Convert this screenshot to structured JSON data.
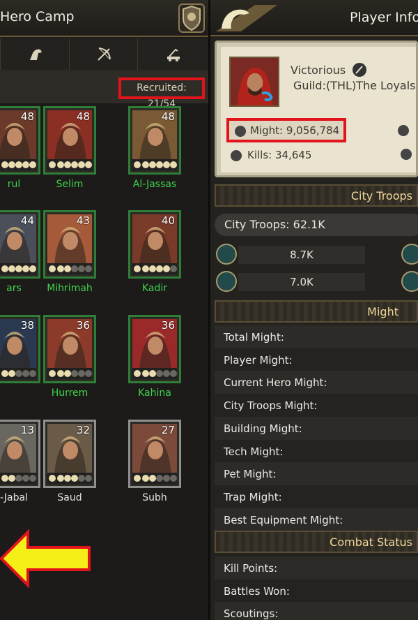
{
  "left": {
    "title": "Hero Camp",
    "recruited": "Recruited: 21/54",
    "heroes": [
      {
        "name": "rul",
        "level": "48",
        "stars": 4
      },
      {
        "name": "Selim",
        "level": "48",
        "stars": 4
      },
      {
        "name": "Al-Jassas",
        "level": "48",
        "stars": 4
      },
      {
        "name": "ars",
        "level": "44",
        "stars": 4
      },
      {
        "name": "Mihrimah",
        "level": "43",
        "stars": 1
      },
      {
        "name": "Kadir",
        "level": "40",
        "stars": 3
      },
      {
        "name": "",
        "level": "38",
        "stars": 1
      },
      {
        "name": "Hurrem",
        "level": "36",
        "stars": 1
      },
      {
        "name": "Kahina",
        "level": "36",
        "stars": 1
      },
      {
        "name": "-Jabal",
        "level": "13",
        "stars": 1
      },
      {
        "name": "Saud",
        "level": "32",
        "stars": 2
      },
      {
        "name": "Subh",
        "level": "27",
        "stars": 1
      }
    ]
  },
  "right": {
    "title": "Player Info",
    "player_name": "Victorious",
    "guild": "Guild:(THL)The Loyals",
    "might": "Might: 9,056,784",
    "kills": "Kills: 34,645",
    "section_city_troops": "City Troops",
    "city_troops_total": "City Troops: 62.1K",
    "troop_rows": [
      "8.7K",
      "7.0K"
    ],
    "section_might": "Might",
    "might_rows": [
      "Total Might:",
      "Player Might:",
      "Current Hero Might:",
      "City Troops Might:",
      "Building Might:",
      "Tech Might:",
      "Pet Might:",
      "Trap Might:",
      "Best Equipment Might:"
    ],
    "section_combat": "Combat Status",
    "combat_rows": [
      "Kill Points:",
      "Battles Won:",
      "Scoutings:"
    ]
  },
  "colors": {
    "highlight": "#e1131b",
    "arrow_fill": "#f6ee17",
    "green_name": "#3ed34a"
  }
}
